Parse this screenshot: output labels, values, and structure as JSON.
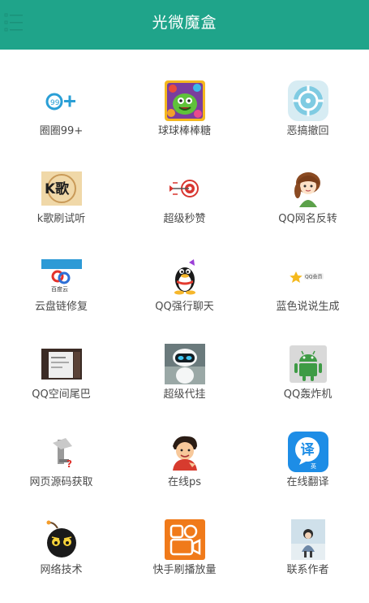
{
  "app": {
    "title": "光微魔盒",
    "menu_icon": "menu-icon"
  },
  "colors": {
    "header_bg": "#1fa48a",
    "background": "#ffffff",
    "label_text": "#4a4a4a"
  },
  "tools": [
    {
      "label": "圈圈99+",
      "icon": "circle-99-icon"
    },
    {
      "label": "球球棒棒糖",
      "icon": "ball-game-icon"
    },
    {
      "label": "恶搞撤回",
      "icon": "target-icon"
    },
    {
      "label": "k歌刷试听",
      "icon": "karaoke-icon"
    },
    {
      "label": "超级秒赞",
      "icon": "dartboard-icon"
    },
    {
      "label": "QQ网名反转",
      "icon": "girl-avatar-icon"
    },
    {
      "label": "云盘链修复",
      "icon": "cloud-disk-icon"
    },
    {
      "label": "QQ强行聊天",
      "icon": "qq-penguin-icon"
    },
    {
      "label": "蓝色说说生成",
      "icon": "star-badge-icon"
    },
    {
      "label": "QQ空间尾巴",
      "icon": "phone-photo-icon"
    },
    {
      "label": "超级代挂",
      "icon": "robot-icon"
    },
    {
      "label": "QQ轰炸机",
      "icon": "android-icon"
    },
    {
      "label": "网页源码获取",
      "icon": "web-source-icon"
    },
    {
      "label": "在线ps",
      "icon": "cartoon-boy-icon"
    },
    {
      "label": "在线翻译",
      "icon": "translate-icon"
    },
    {
      "label": "网络技术",
      "icon": "bomb-icon"
    },
    {
      "label": "快手刷播放量",
      "icon": "video-camera-icon"
    },
    {
      "label": "联系作者",
      "icon": "portrait-photo-icon"
    }
  ]
}
